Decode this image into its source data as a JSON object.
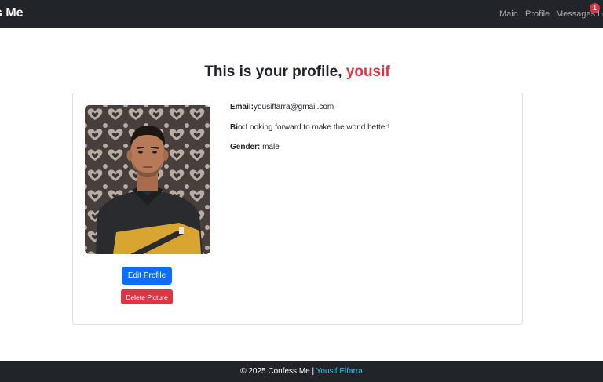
{
  "navbar": {
    "brand": "s Me",
    "items": [
      {
        "label": "Main"
      },
      {
        "label": "Profile"
      },
      {
        "label": "Messages"
      },
      {
        "label": "Lo"
      }
    ],
    "messages_badge": "1"
  },
  "profile": {
    "title_prefix": "This is your profile, ",
    "username": "yousif",
    "email_label": "Email:",
    "email": "yousiffarra@gmail.com",
    "bio_label": "Bio:",
    "bio": "Looking forward to make the world better!",
    "gender_label": "Gender:",
    "gender": " male",
    "edit_button": "Edit Profile",
    "delete_button": "Delete Picture"
  },
  "footer": {
    "text": "© 2025 Confess Me | ",
    "author": "Yousif Elfarra"
  },
  "colors": {
    "navbar_bg": "#212529",
    "accent_red": "#dc3545",
    "primary_blue": "#0d6efd",
    "link_cyan": "#0dcaf0"
  }
}
